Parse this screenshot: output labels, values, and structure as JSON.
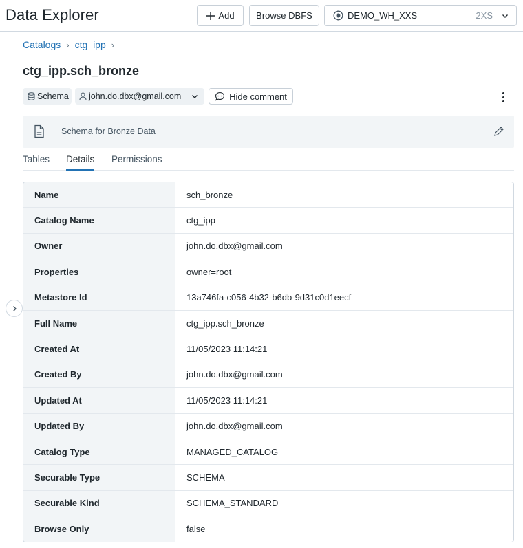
{
  "header": {
    "title": "Data Explorer",
    "add_label": "Add",
    "browse_dbfs_label": "Browse DBFS",
    "warehouse": {
      "name": "DEMO_WH_XXS",
      "size": "2XS"
    }
  },
  "breadcrumb": {
    "items": [
      {
        "label": "Catalogs"
      },
      {
        "label": "ctg_ipp"
      }
    ]
  },
  "schema": {
    "title": "ctg_ipp.sch_bronze",
    "type_tag": "Schema",
    "owner": "john.do.dbx@gmail.com",
    "hide_comment_label": "Hide comment",
    "comment": "Schema for Bronze Data"
  },
  "tabs": [
    {
      "label": "Tables",
      "active": false
    },
    {
      "label": "Details",
      "active": true
    },
    {
      "label": "Permissions",
      "active": false
    }
  ],
  "details": {
    "rows": [
      {
        "key": "Name",
        "value": "sch_bronze"
      },
      {
        "key": "Catalog Name",
        "value": "ctg_ipp"
      },
      {
        "key": "Owner",
        "value": "john.do.dbx@gmail.com"
      },
      {
        "key": "Properties",
        "value": "owner=root"
      },
      {
        "key": "Metastore Id",
        "value": "13a746fa-c056-4b32-b6db-9d31c0d1eecf"
      },
      {
        "key": "Full Name",
        "value": "ctg_ipp.sch_bronze"
      },
      {
        "key": "Created At",
        "value": "11/05/2023 11:14:21"
      },
      {
        "key": "Created By",
        "value": "john.do.dbx@gmail.com"
      },
      {
        "key": "Updated At",
        "value": "11/05/2023 11:14:21"
      },
      {
        "key": "Updated By",
        "value": "john.do.dbx@gmail.com"
      },
      {
        "key": "Catalog Type",
        "value": "MANAGED_CATALOG"
      },
      {
        "key": "Securable Type",
        "value": "SCHEMA"
      },
      {
        "key": "Securable Kind",
        "value": "SCHEMA_STANDARD"
      },
      {
        "key": "Browse Only",
        "value": "false"
      }
    ]
  },
  "icons": {
    "add": "plus-icon",
    "warehouse": "warehouse-status-icon",
    "dropdown": "chevron-down-icon",
    "schema": "database-icon",
    "owner": "user-icon",
    "comment": "speech-bubble-icon",
    "more": "kebab-menu-icon",
    "document": "document-icon",
    "edit": "pencil-icon",
    "expand": "chevron-right-icon"
  },
  "colors": {
    "link": "#2272b4",
    "active_tab_underline": "#2272b4",
    "panel_bg": "#f2f5f7",
    "border": "#d1d9e1"
  }
}
